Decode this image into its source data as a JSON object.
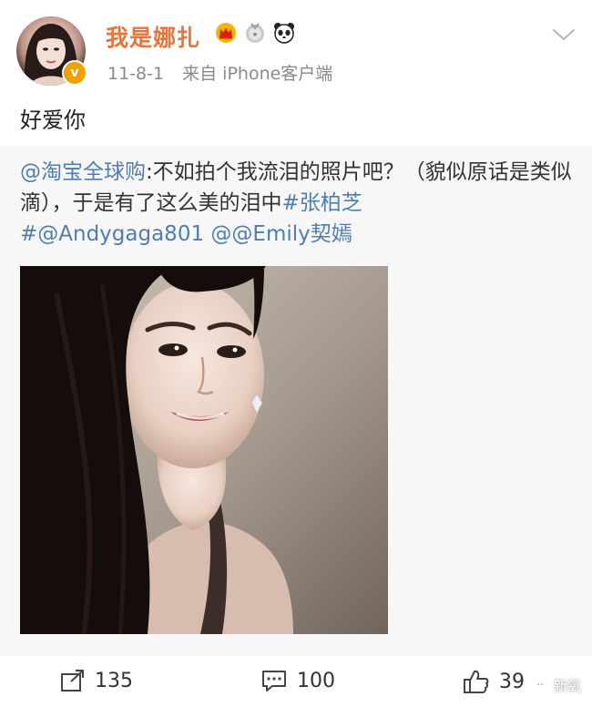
{
  "post": {
    "username": "我是娜扎",
    "badges": [
      "crown-badge-icon",
      "medal-badge-icon",
      "panda-badge-icon"
    ],
    "date": "11-8-1",
    "source": "来自 iPhone客户端",
    "avatar_badge": "v",
    "text": "好爱你"
  },
  "repost": {
    "author_mention": "@淘宝全球购",
    "text_part1": ":不如拍个我流泪的照片吧？（貌似原话是类似滴），于是有了这么美的泪中",
    "hashtag": "#张柏芝",
    "mention2": "#@Andygaga801",
    "mention3": "@@Emily契嫣"
  },
  "actions": {
    "repost_count": "135",
    "comment_count": "100",
    "like_count": "39"
  },
  "watermark": {
    "label": "新氧"
  },
  "colors": {
    "username": "#e8743a",
    "link": "#507daf",
    "meta": "#8a8a8a",
    "repost_bg": "#f7f7f7",
    "verified_badge": "#f0a000"
  }
}
